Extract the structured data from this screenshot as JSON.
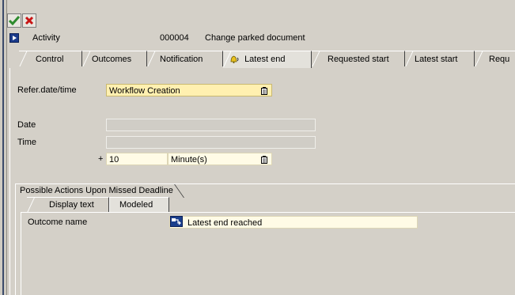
{
  "toolbar": {
    "confirm_icon": "checkmark-icon",
    "cancel_icon": "cancel-icon",
    "confirm_color": "#2e8b2e",
    "cancel_color": "#c81414"
  },
  "activity": {
    "label": "Activity",
    "number": "000004",
    "description": "Change parked document",
    "icon": "navigation-arrow-icon"
  },
  "main_tabs": [
    {
      "label": "Control",
      "active": false
    },
    {
      "label": "Outcomes",
      "active": false
    },
    {
      "label": "Notification",
      "active": false
    },
    {
      "label": "Latest end",
      "active": true,
      "icon": "bell-icon"
    },
    {
      "label": "Requested start",
      "active": false
    },
    {
      "label": "Latest start",
      "active": false
    },
    {
      "label": "Requ",
      "active": false
    }
  ],
  "form": {
    "refer_label": "Refer.date/time",
    "refer_value": "Workflow Creation",
    "date_label": "Date",
    "date_value": "",
    "time_label": "Time",
    "time_value": "",
    "offset_sign": "+",
    "offset_value": "10",
    "offset_unit": "Minute(s)",
    "highlight_color": "#fff0b0"
  },
  "missed_deadline": {
    "title": "Possible Actions Upon Missed Deadline",
    "tabs": [
      {
        "label": "Display text",
        "active": false
      },
      {
        "label": "Modeled",
        "active": true
      }
    ],
    "outcome_label": "Outcome name",
    "outcome_value": "Latest end reached",
    "outcome_icon": "outcome-node-icon"
  }
}
